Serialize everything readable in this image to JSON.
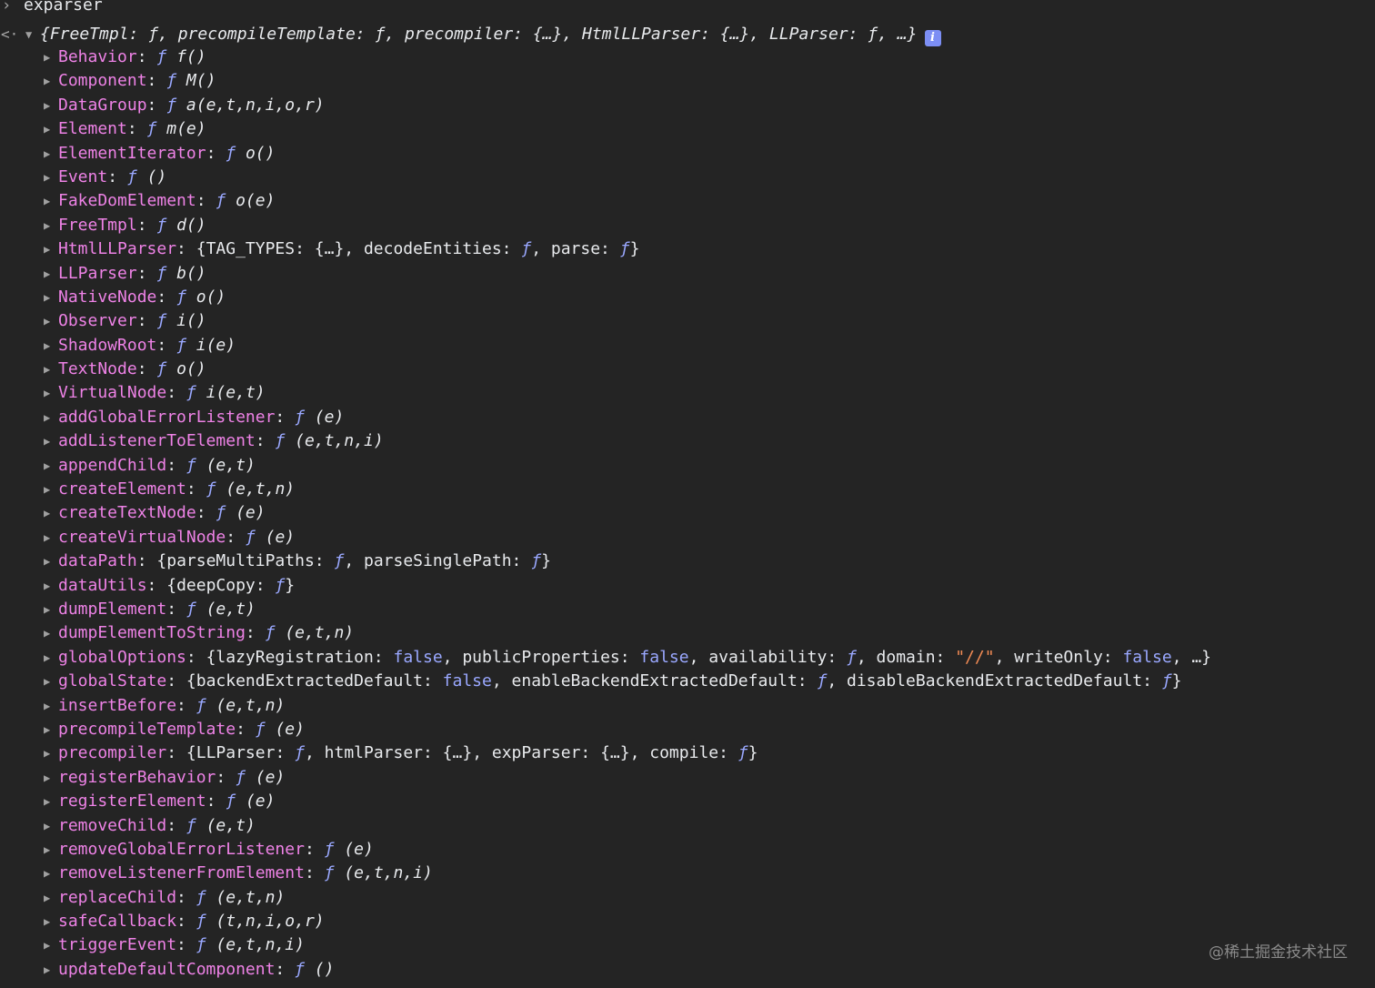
{
  "console": {
    "prompt_caret": "›",
    "prompt_text": "exparser",
    "result_caret": "<·",
    "summary_text": "{FreeTmpl: ƒ, precompileTemplate: ƒ, precompiler: {…}, HtmlLLParser: {…}, LLParser: ƒ, …}",
    "info_badge": "i",
    "properties": [
      {
        "key": "Behavior",
        "kind": "fn",
        "value": "f()"
      },
      {
        "key": "Component",
        "kind": "fn",
        "value": "M()"
      },
      {
        "key": "DataGroup",
        "kind": "fn",
        "value": "a(e,t,n,i,o,r)"
      },
      {
        "key": "Element",
        "kind": "fn",
        "value": "m(e)"
      },
      {
        "key": "ElementIterator",
        "kind": "fn",
        "value": "o()"
      },
      {
        "key": "Event",
        "kind": "fn",
        "value": "()"
      },
      {
        "key": "FakeDomElement",
        "kind": "fn",
        "value": "o(e)"
      },
      {
        "key": "FreeTmpl",
        "kind": "fn",
        "value": "d()"
      },
      {
        "key": "HtmlLLParser",
        "kind": "obj",
        "value": "{TAG_TYPES: {…}, decodeEntities: ƒ, parse: ƒ}"
      },
      {
        "key": "LLParser",
        "kind": "fn",
        "value": "b()"
      },
      {
        "key": "NativeNode",
        "kind": "fn",
        "value": "o()"
      },
      {
        "key": "Observer",
        "kind": "fn",
        "value": "i()"
      },
      {
        "key": "ShadowRoot",
        "kind": "fn",
        "value": "i(e)"
      },
      {
        "key": "TextNode",
        "kind": "fn",
        "value": "o()"
      },
      {
        "key": "VirtualNode",
        "kind": "fn",
        "value": "i(e,t)"
      },
      {
        "key": "addGlobalErrorListener",
        "kind": "fn",
        "value": "(e)"
      },
      {
        "key": "addListenerToElement",
        "kind": "fn",
        "value": "(e,t,n,i)"
      },
      {
        "key": "appendChild",
        "kind": "fn",
        "value": "(e,t)"
      },
      {
        "key": "createElement",
        "kind": "fn",
        "value": "(e,t,n)"
      },
      {
        "key": "createTextNode",
        "kind": "fn",
        "value": "(e)"
      },
      {
        "key": "createVirtualNode",
        "kind": "fn",
        "value": "(e)"
      },
      {
        "key": "dataPath",
        "kind": "obj",
        "value": "{parseMultiPaths: ƒ, parseSinglePath: ƒ}"
      },
      {
        "key": "dataUtils",
        "kind": "obj",
        "value": "{deepCopy: ƒ}"
      },
      {
        "key": "dumpElement",
        "kind": "fn",
        "value": "(e,t)"
      },
      {
        "key": "dumpElementToString",
        "kind": "fn",
        "value": "(e,t,n)"
      },
      {
        "key": "globalOptions",
        "kind": "obj",
        "value": "{lazyRegistration: false, publicProperties: false, availability: ƒ, domain: \"//\", writeOnly: false, …}"
      },
      {
        "key": "globalState",
        "kind": "obj",
        "value": "{backendExtractedDefault: false, enableBackendExtractedDefault: ƒ, disableBackendExtractedDefault: ƒ}"
      },
      {
        "key": "insertBefore",
        "kind": "fn",
        "value": "(e,t,n)"
      },
      {
        "key": "precompileTemplate",
        "kind": "fn",
        "value": "(e)"
      },
      {
        "key": "precompiler",
        "kind": "obj",
        "value": "{LLParser: ƒ, htmlParser: {…}, expParser: {…}, compile: ƒ}"
      },
      {
        "key": "registerBehavior",
        "kind": "fn",
        "value": "(e)"
      },
      {
        "key": "registerElement",
        "kind": "fn",
        "value": "(e)"
      },
      {
        "key": "removeChild",
        "kind": "fn",
        "value": "(e,t)"
      },
      {
        "key": "removeGlobalErrorListener",
        "kind": "fn",
        "value": "(e)"
      },
      {
        "key": "removeListenerFromElement",
        "kind": "fn",
        "value": "(e,t,n,i)"
      },
      {
        "key": "replaceChild",
        "kind": "fn",
        "value": "(e,t,n)"
      },
      {
        "key": "safeCallback",
        "kind": "fn",
        "value": "(t,n,i,o,r)"
      },
      {
        "key": "triggerEvent",
        "kind": "fn",
        "value": "(e,t,n,i)"
      },
      {
        "key": "updateDefaultComponent",
        "kind": "fn",
        "value": "()"
      }
    ]
  },
  "watermark": "@稀土掘金技术社区",
  "colors": {
    "background": "#242424",
    "key": "#ee82e6",
    "function_marker": "#9aa8ff",
    "boolean": "#9aa8ff",
    "string": "#f28b54",
    "text": "#e8eaed"
  }
}
